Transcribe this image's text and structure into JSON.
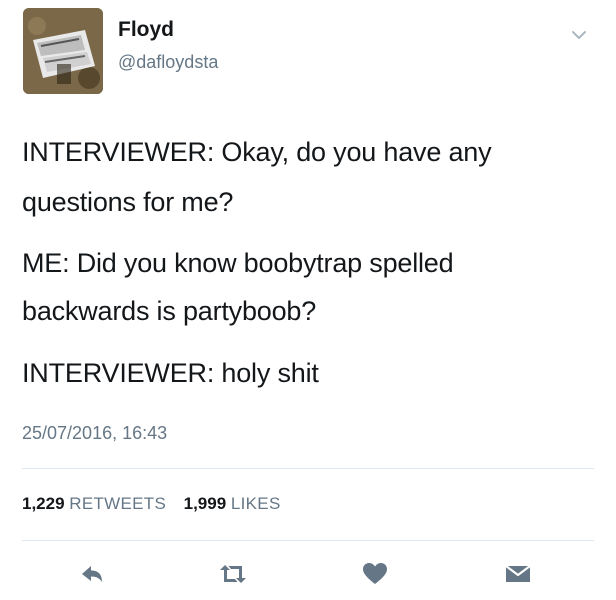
{
  "author": {
    "name": "Floyd",
    "handle": "@dafloydsta"
  },
  "tweet": {
    "lines": [
      "INTERVIEWER: Okay, do you have any",
      "questions for me?",
      "ME: Did you know boobytrap spelled",
      "backwards is partyboob?",
      "INTERVIEWER: holy shit"
    ],
    "timestamp": "25/07/2016, 16:43"
  },
  "stats": {
    "retweets_count": "1,229",
    "retweets_label": "RETWEETS",
    "likes_count": "1,999",
    "likes_label": "LIKES"
  },
  "actions": {
    "icons": [
      "reply-icon",
      "retweet-icon",
      "like-icon",
      "direct-message-icon"
    ],
    "color": "#657786"
  }
}
